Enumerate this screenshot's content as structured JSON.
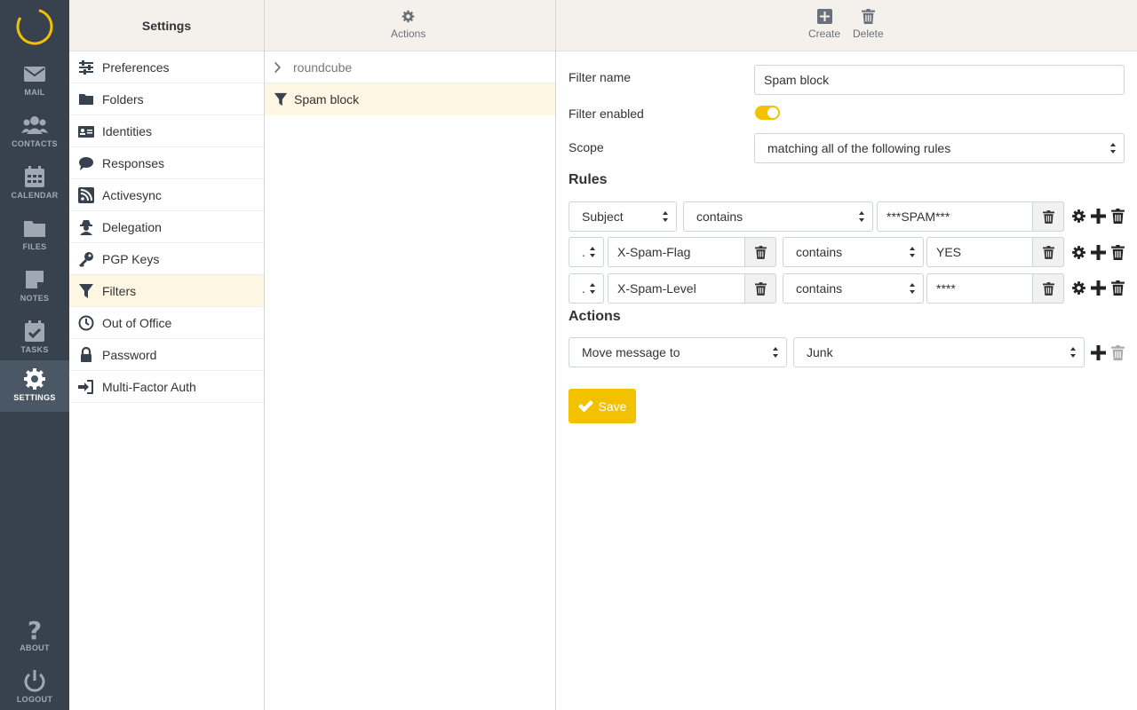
{
  "nav": {
    "mail": "MAIL",
    "contacts": "CONTACTS",
    "calendar": "CALENDAR",
    "files": "FILES",
    "notes": "NOTES",
    "tasks": "TASKS",
    "settings": "SETTINGS",
    "about": "ABOUT",
    "logout": "LOGOUT"
  },
  "settings": {
    "title": "Settings",
    "items": [
      "Preferences",
      "Folders",
      "Identities",
      "Responses",
      "Activesync",
      "Delegation",
      "PGP Keys",
      "Filters",
      "Out of Office",
      "Password",
      "Multi-Factor Auth"
    ]
  },
  "filters_panel": {
    "actions_label": "Actions",
    "filter_set": "roundcube",
    "filter_name": "Spam block"
  },
  "toolbar": {
    "create_label": "Create",
    "delete_label": "Delete"
  },
  "form": {
    "filter_name_label": "Filter name",
    "filter_name_value": "Spam block",
    "filter_enabled_label": "Filter enabled",
    "filter_enabled": true,
    "scope_label": "Scope",
    "scope_value": "matching all of the following rules",
    "rules_heading": "Rules",
    "rules": [
      {
        "header": "Subject",
        "op": "contains",
        "value": "***SPAM***"
      },
      {
        "header_select": ".",
        "header": "X-Spam-Flag",
        "op": "contains",
        "value": "YES"
      },
      {
        "header_select": ".",
        "header": "X-Spam-Level",
        "op": "contains",
        "value": "****"
      }
    ],
    "actions_heading": "Actions",
    "action": {
      "type": "Move message to",
      "target": "Junk"
    },
    "save_label": "Save"
  },
  "colors": {
    "accent": "#f2c200",
    "rail": "#37424e",
    "selected_row": "#fdf6e3"
  }
}
